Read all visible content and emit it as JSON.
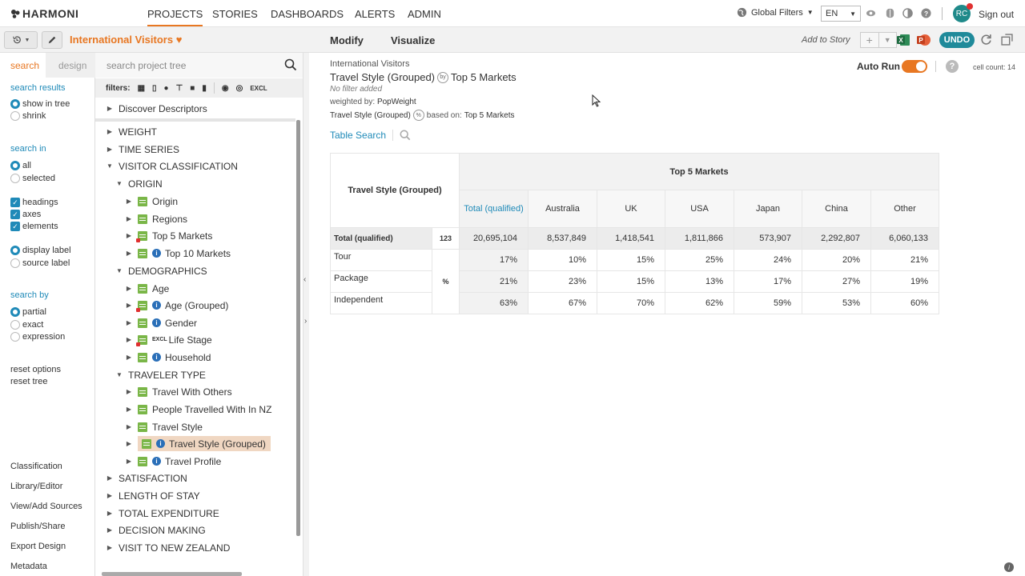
{
  "app": {
    "logo": "HARMONI"
  },
  "nav": {
    "items": [
      {
        "label": "PROJECTS",
        "active": true
      },
      {
        "label": "STORIES"
      },
      {
        "label": "DASHBOARDS"
      },
      {
        "label": "ALERTS"
      },
      {
        "label": "ADMIN"
      }
    ],
    "global_filters": "Global Filters",
    "language": "EN",
    "avatar_initials": "RC",
    "sign_out": "Sign out"
  },
  "project": {
    "title": "International Visitors"
  },
  "toolbar": {
    "modify": "Modify",
    "visualize": "Visualize",
    "add_to_story": "Add to Story",
    "undo": "UNDO"
  },
  "search_panel": {
    "tabs": [
      "search",
      "design"
    ],
    "search_results_heading": "search results",
    "search_results_opts": [
      "show in tree",
      "shrink"
    ],
    "search_in_heading": "search in",
    "search_in_opts": [
      "all",
      "selected"
    ],
    "checks": [
      "headings",
      "axes",
      "elements"
    ],
    "label_opts": [
      "display label",
      "source label"
    ],
    "search_by_heading": "search by",
    "search_by_opts": [
      "partial",
      "exact",
      "expression"
    ],
    "reset_options": "reset options",
    "reset_tree": "reset tree",
    "bottom_links": [
      "Classification",
      "Library/Editor",
      "View/Add Sources",
      "Publish/Share",
      "Export Design",
      "Metadata"
    ]
  },
  "tree": {
    "search_placeholder": "search project tree",
    "filters_label": "filters:",
    "excl_label": "EXCL",
    "discover": "Discover Descriptors",
    "nodes": {
      "weight": "WEIGHT",
      "time_series": "TIME SERIES",
      "visitor_classification": "VISITOR CLASSIFICATION",
      "origin_group": "ORIGIN",
      "origin": "Origin",
      "regions": "Regions",
      "top5": "Top 5 Markets",
      "top10": "Top 10 Markets",
      "demographics": "DEMOGRAPHICS",
      "age": "Age",
      "age_grouped": "Age (Grouped)",
      "gender": "Gender",
      "life_stage_excl": "EXCL",
      "life_stage": "Life Stage",
      "household": "Household",
      "traveler_type": "TRAVELER TYPE",
      "travel_with_others": "Travel With Others",
      "people_travelled": "People Travelled With In NZ",
      "travel_style": "Travel Style",
      "travel_style_grouped": "Travel Style (Grouped)",
      "travel_profile": "Travel Profile",
      "satisfaction": "SATISFACTION",
      "length_of_stay": "LENGTH OF STAY",
      "total_expenditure": "TOTAL EXPENDITURE",
      "decision_making": "DECISION MAKING",
      "visit_to_nz": "VISIT TO NEW ZEALAND"
    }
  },
  "query": {
    "breadcrumb": "International Visitors",
    "row_var": "Travel Style (Grouped)",
    "by": "by",
    "col_var": "Top 5 Markets",
    "no_filter": "No filter added",
    "weighted_prefix": "weighted by:",
    "weight_name": "PopWeight",
    "base_var": "Travel Style (Grouped)",
    "base_badge": "%",
    "based_on_prefix": "based on:",
    "based_on": "Top 5 Markets",
    "table_search": "Table Search",
    "auto_run": "Auto Run",
    "cell_count": "cell count: 14"
  },
  "table": {
    "corner_label": "Travel Style (Grouped)",
    "col_group": "Top 5 Markets",
    "columns": [
      "Total (qualified)",
      "Australia",
      "UK",
      "USA",
      "Japan",
      "China",
      "Other"
    ],
    "total_row": {
      "label": "Total (qualified)",
      "stat": "123",
      "values": [
        "20,695,104",
        "8,537,849",
        "1,418,541",
        "1,811,866",
        "573,907",
        "2,292,807",
        "6,060,133"
      ]
    },
    "pct_stat": "%",
    "rows": [
      {
        "label": "Tour",
        "values": [
          "17%",
          "10%",
          "15%",
          "25%",
          "24%",
          "20%",
          "21%"
        ]
      },
      {
        "label": "Package",
        "values": [
          "21%",
          "23%",
          "15%",
          "13%",
          "17%",
          "27%",
          "19%"
        ]
      },
      {
        "label": "Independent",
        "values": [
          "63%",
          "67%",
          "70%",
          "62%",
          "59%",
          "53%",
          "60%"
        ]
      }
    ]
  },
  "colors": {
    "accent": "#e87722",
    "link": "#1f8ab8",
    "teal": "#1f8a9a"
  }
}
